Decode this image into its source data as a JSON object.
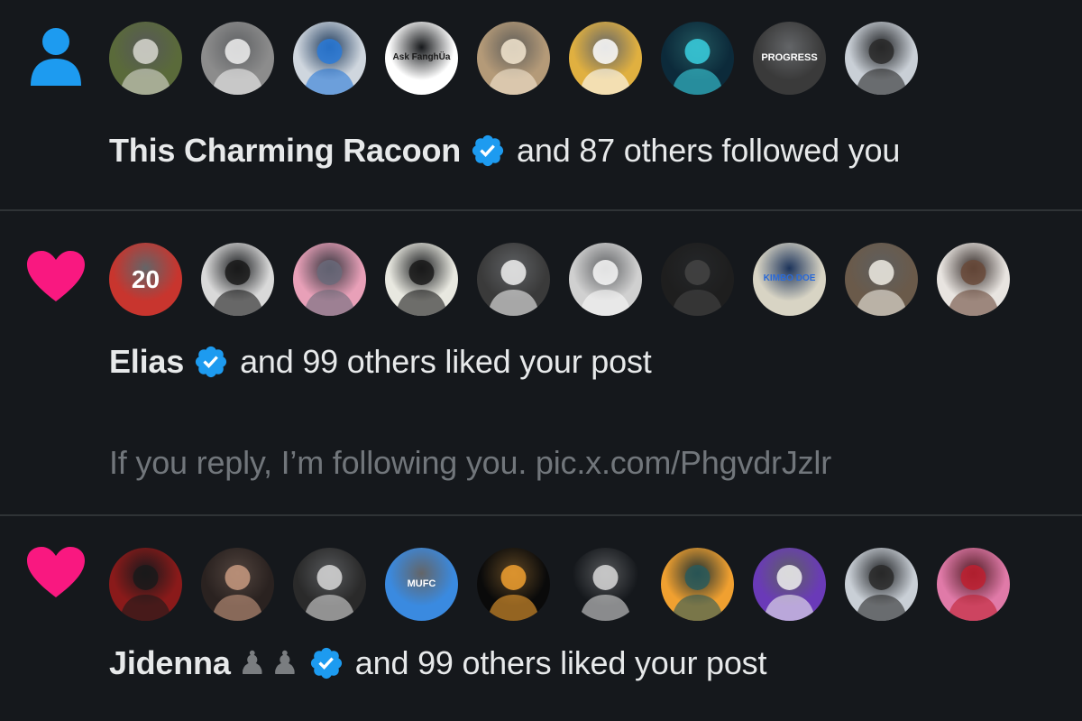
{
  "notifications": [
    {
      "type": "follow",
      "type_icon": "person-icon",
      "avatars": [
        {
          "name": "raccoon-avatar",
          "bg": "#5a6a3a",
          "fg": "#d8d8d0",
          "label": ""
        },
        {
          "name": "user-hat-avatar",
          "bg": "#8c8c8c",
          "fg": "#f0f0f0",
          "label": ""
        },
        {
          "name": "white-abstract-avatar",
          "bg": "#cfd6de",
          "fg": "#2a7ad8",
          "label": ""
        },
        {
          "name": "ask-fanghua-avatar",
          "bg": "#ffffff",
          "fg": "#1a1a1a",
          "label": "Ask FanghÜa"
        },
        {
          "name": "bearded-man-avatar",
          "bg": "#b49a78",
          "fg": "#f3e6d0",
          "label": ""
        },
        {
          "name": "duck-avatar",
          "bg": "#e0b040",
          "fg": "#ffffff",
          "label": ""
        },
        {
          "name": "crystal-face-avatar",
          "bg": "#0c2a3a",
          "fg": "#3ad0e0",
          "label": ""
        },
        {
          "name": "progress-avatar",
          "bg": "#3a3a3a",
          "fg": "#ffffff",
          "label": "PROGRESS"
        },
        {
          "name": "man-shirt-avatar",
          "bg": "#c9cfd6",
          "fg": "#2a2a2a",
          "label": ""
        }
      ],
      "name": "This Charming Racoon",
      "verified": true,
      "emojis": [],
      "rest": "and 87 others followed you",
      "preview": ""
    },
    {
      "type": "like",
      "type_icon": "heart-icon",
      "avatars": [
        {
          "name": "football-player-avatar",
          "bg": "#c8352e",
          "fg": "#ffffff",
          "label": "20"
        },
        {
          "name": "afro-boy-avatar",
          "bg": "#d9d9d9",
          "fg": "#1a1a1a",
          "label": ""
        },
        {
          "name": "cartoon-cat-avatar",
          "bg": "#e8a0b8",
          "fg": "#6a6a7a",
          "label": ""
        },
        {
          "name": "colorful-hat-avatar",
          "bg": "#e8e8e0",
          "fg": "#1a1a1a",
          "label": ""
        },
        {
          "name": "anime-girl-avatar",
          "bg": "#3a3a3a",
          "fg": "#f0f0f0",
          "label": ""
        },
        {
          "name": "man-white-avatar",
          "bg": "#d0d0d0",
          "fg": "#f8f8f8",
          "label": ""
        },
        {
          "name": "black-cat-avatar",
          "bg": "#1e1e1e",
          "fg": "#444444",
          "label": ""
        },
        {
          "name": "kimbo-doe-avatar",
          "bg": "#d8d4c4",
          "fg": "#2a6ad8",
          "label": "KIMBO DOE"
        },
        {
          "name": "young-man-avatar",
          "bg": "#6a5a4a",
          "fg": "#f0ece4",
          "label": ""
        },
        {
          "name": "smiling-woman-avatar",
          "bg": "#e8e4e0",
          "fg": "#6a4a3a",
          "label": ""
        }
      ],
      "name": "Elias",
      "verified": true,
      "emojis": [],
      "rest": "and 99 others liked your post",
      "preview": "If you reply, I’m following you. pic.x.com/PhgvdrJzlr"
    },
    {
      "type": "like",
      "type_icon": "heart-icon",
      "avatars": [
        {
          "name": "cartoon-boy-avatar",
          "bg": "#8a1a1a",
          "fg": "#1a1a1a",
          "label": ""
        },
        {
          "name": "woman-dark-avatar",
          "bg": "#2a2220",
          "fg": "#c89a80",
          "label": ""
        },
        {
          "name": "standing-cat-avatar",
          "bg": "#2a2a2a",
          "fg": "#d8d8d8",
          "label": ""
        },
        {
          "name": "mufc-avatar",
          "bg": "#3a8ae0",
          "fg": "#ffffff",
          "label": "MUFC"
        },
        {
          "name": "eclipse-avatar",
          "bg": "#0a0a0a",
          "fg": "#f0a030",
          "label": ""
        },
        {
          "name": "sketch-face-avatar",
          "bg": "#15181c",
          "fg": "#d8d8d8",
          "label": ""
        },
        {
          "name": "cap-man-avatar",
          "bg": "#f0a030",
          "fg": "#2a5a5a",
          "label": ""
        },
        {
          "name": "singer-avatar",
          "bg": "#6a3ab8",
          "fg": "#f0f0f0",
          "label": ""
        },
        {
          "name": "man-shirt-2-avatar",
          "bg": "#c9cfd6",
          "fg": "#2a2a2a",
          "label": ""
        },
        {
          "name": "cap-man-pink-avatar",
          "bg": "#e07aa8",
          "fg": "#c02030",
          "label": ""
        }
      ],
      "name": "Jidenna",
      "verified": true,
      "emojis": [
        "♟",
        "♟"
      ],
      "rest": "and 99 others liked your post",
      "preview": ""
    }
  ],
  "colors": {
    "background": "#15181c",
    "divider": "#2f3336",
    "follow_icon": "#1d9bf0",
    "heart": "#f91880",
    "verified": "#1d9bf0",
    "primary_text": "#e7e9ea",
    "secondary_text": "#71767b"
  }
}
